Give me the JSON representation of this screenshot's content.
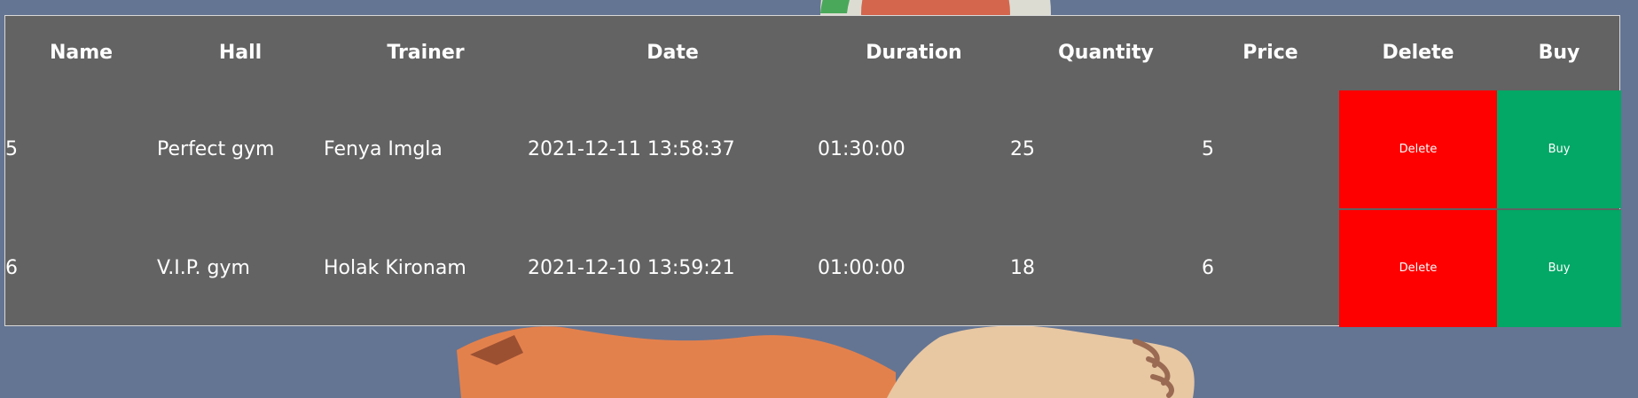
{
  "colors": {
    "page_background": "#647593",
    "table_background": "#636363",
    "delete_button": "#ff0000",
    "buy_button": "#03a766"
  },
  "table": {
    "headers": [
      "Name",
      "Hall",
      "Trainer",
      "Date",
      "Duration",
      "Quantity",
      "Price",
      "Delete",
      "Buy"
    ],
    "rows": [
      {
        "name": "5",
        "hall": "Perfect gym",
        "trainer": "Fenya Imgla",
        "date": "2021-12-11 13:58:37",
        "duration": "01:30:00",
        "quantity": "25",
        "price": "5",
        "delete_label": "Delete",
        "buy_label": "Buy"
      },
      {
        "name": "6",
        "hall": "V.I.P. gym",
        "trainer": "Holak Kironam",
        "date": "2021-12-10 13:59:21",
        "duration": "01:00:00",
        "quantity": "18",
        "price": "6",
        "delete_label": "Delete",
        "buy_label": "Buy"
      }
    ]
  }
}
